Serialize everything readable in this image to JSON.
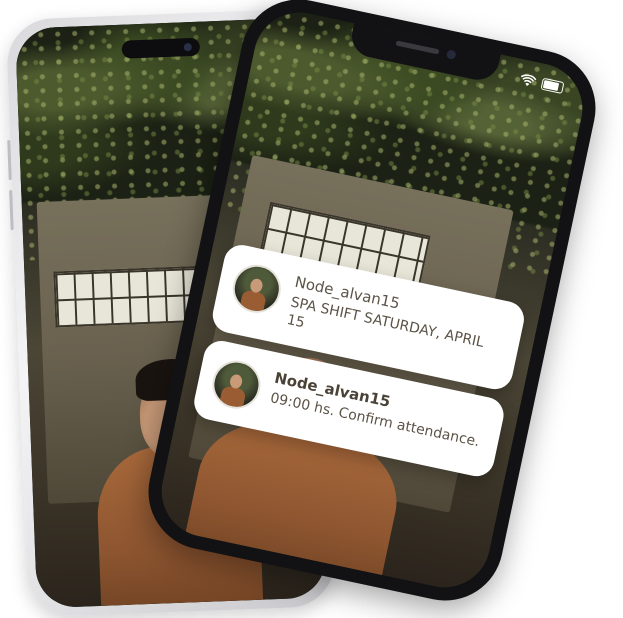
{
  "notifications": [
    {
      "sender": "Node_alvan15",
      "message": "SPA SHIFT SATURDAY, APRIL 15"
    },
    {
      "sender": "Node_alvan15",
      "message": "09:00 hs. Confirm attendance."
    }
  ],
  "colors": {
    "notification_bg": "#ffffff",
    "notification_text": "#5c5347",
    "front_frame": "#121214",
    "back_frame": "#d9d9dc"
  },
  "icons": [
    "wifi-icon",
    "battery-icon"
  ]
}
